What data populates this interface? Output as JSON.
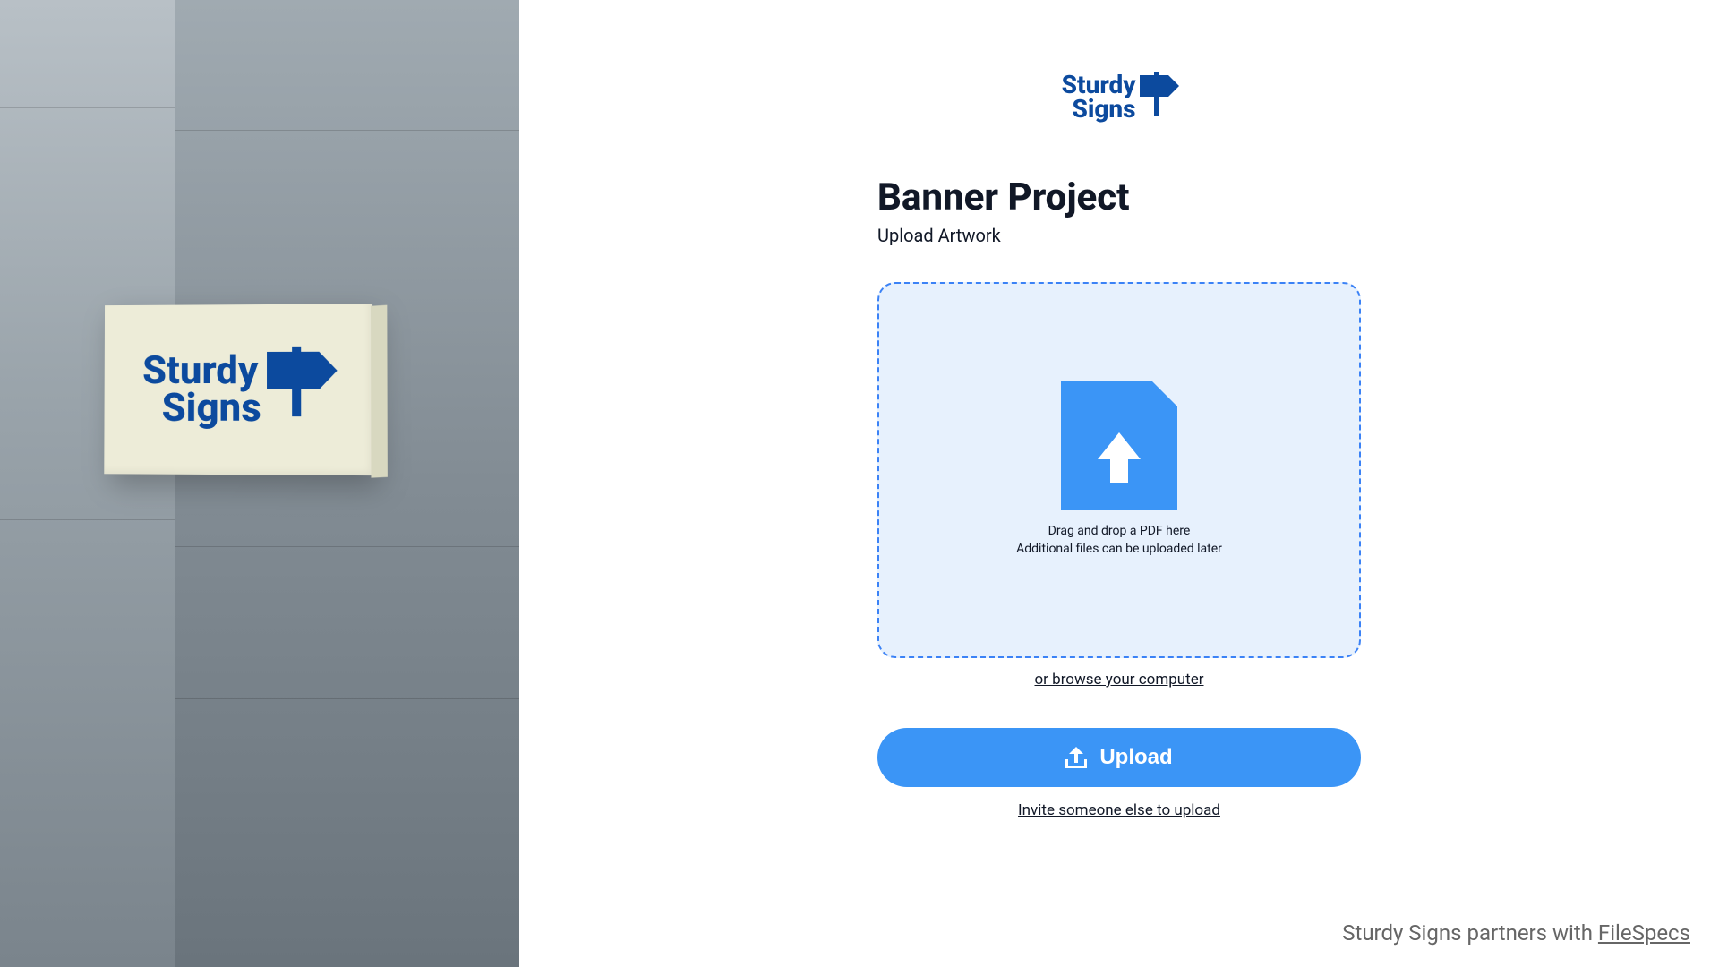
{
  "brand": {
    "name_line1": "Sturdy",
    "name_line2": "Signs",
    "primary_color": "#0c4a9e",
    "accent_color": "#3b95f6"
  },
  "page": {
    "title": "Banner Project",
    "subtitle": "Upload Artwork"
  },
  "dropzone": {
    "line1": "Drag and drop a PDF here",
    "line2": "Additional files can be uploaded later",
    "browse_label": "or browse your computer",
    "icon": "file-upload-icon"
  },
  "actions": {
    "upload_label": "Upload",
    "invite_label": "Invite someone else to upload"
  },
  "footer": {
    "partner_prefix": "Sturdy Signs partners with ",
    "partner_name": "FileSpecs"
  }
}
